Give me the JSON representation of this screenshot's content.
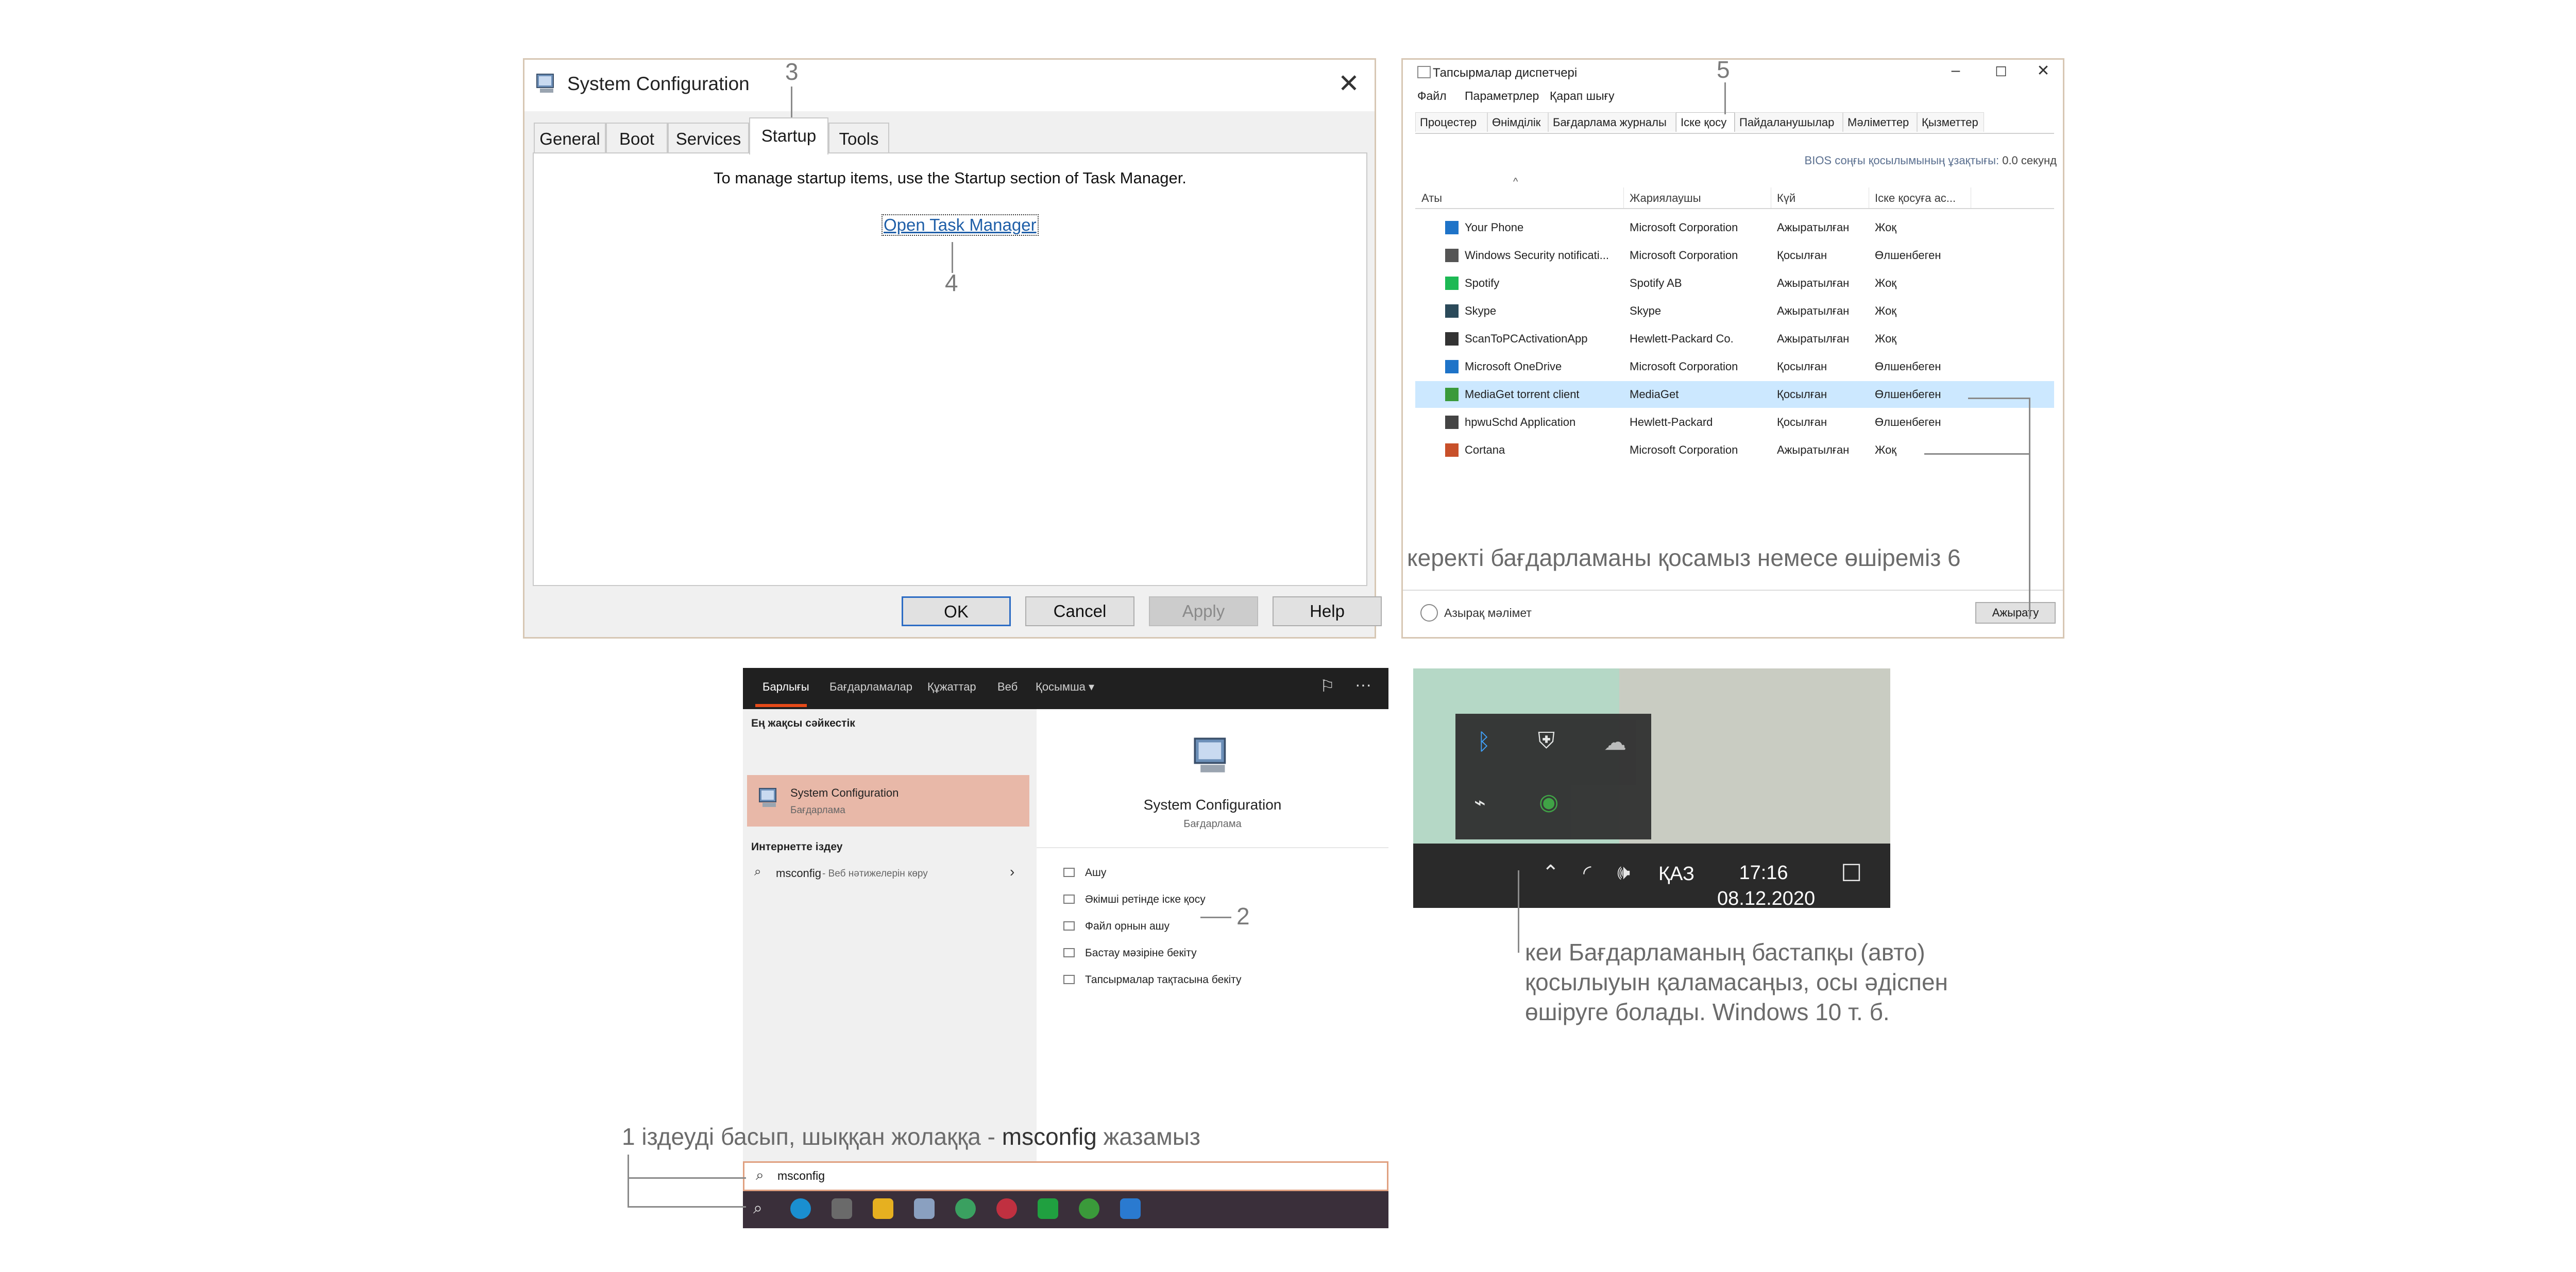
{
  "msconfig": {
    "title": "System Configuration",
    "tabs": [
      "General",
      "Boot",
      "Services",
      "Startup",
      "Tools"
    ],
    "active_tab": "Startup",
    "info_text": "To manage startup items, use the Startup section of Task Manager.",
    "link_text": "Open Task Manager",
    "buttons": {
      "ok": "OK",
      "cancel": "Cancel",
      "apply": "Apply",
      "help": "Help"
    }
  },
  "callouts": {
    "one": "1",
    "two": "2",
    "three": "3",
    "four": "4",
    "five": "5",
    "six": "6"
  },
  "taskmgr": {
    "title": "Тапсырмалар диспетчері",
    "menu": [
      "Файл",
      "Параметрлер",
      "Қарап шығу"
    ],
    "tabs": [
      "Процестер",
      "Өнімділік",
      "Бағдарлама журналы",
      "Іске қосу",
      "Пайдаланушылар",
      "Мәліметтер",
      "Қызметтер"
    ],
    "active_tab": "Іске қосу",
    "bios_label": "BIOS соңғы қосылымының ұзақтығы:",
    "bios_value": "0.0 секунд",
    "columns": [
      "Аты",
      "Жариялаушы",
      "Күй",
      "Іске қосуға ас..."
    ],
    "rows": [
      {
        "name": "Your Phone",
        "publisher": "Microsoft Corporation",
        "status": "Ажыратылған",
        "impact": "Жоқ",
        "icon": "your-phone-icon",
        "color": "#1e73c8"
      },
      {
        "name": "Windows Security notificati...",
        "publisher": "Microsoft Corporation",
        "status": "Қосылған",
        "impact": "Өлшенбеген",
        "icon": "shield-icon",
        "color": "#555555"
      },
      {
        "name": "Spotify",
        "publisher": "Spotify AB",
        "status": "Ажыратылған",
        "impact": "Жоқ",
        "icon": "spotify-icon",
        "color": "#1db954"
      },
      {
        "name": "Skype",
        "publisher": "Skype",
        "status": "Ажыратылған",
        "impact": "Жоқ",
        "icon": "skype-icon",
        "color": "#2b4a5a"
      },
      {
        "name": "ScanToPCActivationApp",
        "publisher": "Hewlett-Packard Co.",
        "status": "Ажыратылған",
        "impact": "Жоқ",
        "icon": "hp-scan-icon",
        "color": "#333333"
      },
      {
        "name": "Microsoft OneDrive",
        "publisher": "Microsoft Corporation",
        "status": "Қосылған",
        "impact": "Өлшенбеген",
        "icon": "onedrive-icon",
        "color": "#1e73c8"
      },
      {
        "name": "MediaGet torrent client",
        "publisher": "MediaGet",
        "status": "Қосылған",
        "impact": "Өлшенбеген",
        "icon": "mediaget-icon",
        "color": "#3a9a3a"
      },
      {
        "name": "hpwuSchd Application",
        "publisher": "Hewlett-Packard",
        "status": "Қосылған",
        "impact": "Өлшенбеген",
        "icon": "hp-app-icon",
        "color": "#444444"
      },
      {
        "name": "Cortana",
        "publisher": "Microsoft Corporation",
        "status": "Ажыратылған",
        "impact": "Жоқ",
        "icon": "cortana-icon",
        "color": "#c8502a"
      }
    ],
    "selected_row": "MediaGet torrent client",
    "caption": "керекті бағдарламаны қосамыз немесе өшіреміз 6",
    "fewer_details": "Азырақ мәлімет",
    "disable_button": "Ажырату"
  },
  "search": {
    "tabs": [
      "Барлығы",
      "Бағдарламалар",
      "Құжаттар",
      "Веб",
      "Қосымша ▾"
    ],
    "best_match_header": "Ең жақсы сәйкестік",
    "best_match_title": "System Configuration",
    "best_match_sub": "Бағдарлама",
    "web_header": "Интернетте іздеу",
    "web_query": "msconfig",
    "web_suffix": " - Веб нәтижелерін көру",
    "detail_title": "System Configuration",
    "detail_sub": "Бағдарлама",
    "actions": [
      "Ашу",
      "Әкімші ретінде іске қосу",
      "Файл орнын ашу",
      "Бастау мәзіріне бекіту",
      "Тапсырмалар тақтасына бекіту"
    ],
    "query": "msconfig"
  },
  "caption1": {
    "prefix": "1 іздеуді басып, шыққан жолаққа - ",
    "keyword": "msconfig",
    "suffix": " жазамыз"
  },
  "tray": {
    "language": "ҚАЗ",
    "time": "17:16",
    "date": "08.12.2020"
  },
  "caption2": {
    "line1": "кеи Бағдарламаның бастапқы (авто)",
    "line2": "қосылыуын қаламасаңыз, осы әдіспен",
    "line3": "өшіруге болады. Windows 10 т. б."
  }
}
